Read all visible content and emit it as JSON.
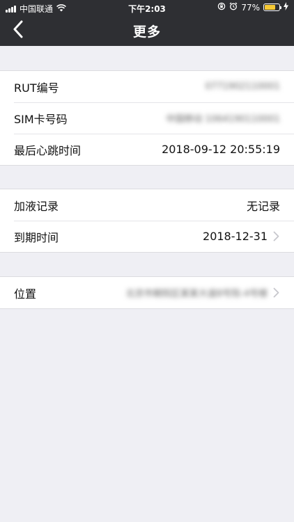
{
  "status_bar": {
    "carrier": "中国联通",
    "time": "下午2:03",
    "battery_text": "77%",
    "battery_level": 0.77,
    "battery_color": "#f6c935"
  },
  "nav": {
    "title": "更多",
    "back_icon": "chevron-left-icon"
  },
  "groups": [
    {
      "rows": [
        {
          "label": "RUT编号",
          "value": "0771902110001",
          "blurred": true,
          "chevron": false
        },
        {
          "label": "SIM卡号码",
          "value": "中国移动 1064190110001",
          "blurred": true,
          "chevron": false
        },
        {
          "label": "最后心跳时间",
          "value": "2018-09-12 20:55:19",
          "blurred": false,
          "chevron": false
        }
      ]
    },
    {
      "rows": [
        {
          "label": "加液记录",
          "value": "无记录",
          "blurred": false,
          "chevron": false
        },
        {
          "label": "到期时间",
          "value": "2018-12-31",
          "blurred": false,
          "chevron": true
        }
      ]
    },
    {
      "rows": [
        {
          "label": "位置",
          "value": "北京市朝阳区某某大道8号院-4号楼",
          "blurred": true,
          "chevron": true
        }
      ]
    }
  ],
  "colors": {
    "nav_background": "#2e2f33",
    "page_background": "#efeff4",
    "chevron": "#c7c7cc"
  }
}
